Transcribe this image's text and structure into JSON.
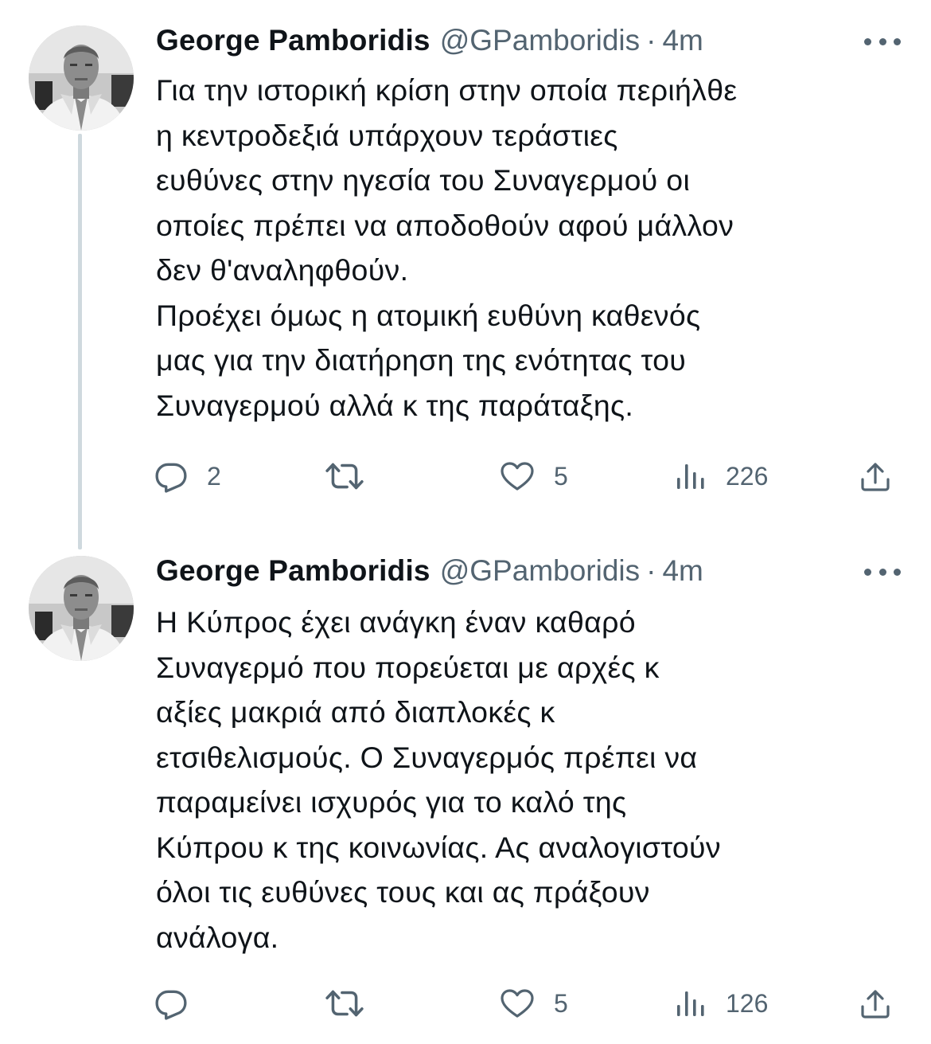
{
  "tweets": [
    {
      "author": {
        "name": "George Pamboridis",
        "handle": "@GPamboridis",
        "separator": "·",
        "time": "4m"
      },
      "text_lines": [
        "Για την ιστορική κρίση στην οποία περιήλθε",
        "η κεντροδεξιά υπάρχουν τεράστιες",
        "ευθύνες στην ηγεσία του Συναγερμού οι",
        "οποίες πρέπει να αποδοθούν αφού μάλλον",
        "δεν θ'αναληφθούν.",
        "Προέχει όμως η ατομική ευθύνη καθενός",
        "μας για την διατήρηση της ενότητας του",
        "Συναγερμού αλλά κ της παράταξης."
      ],
      "stats": {
        "replies": "2",
        "retweets": "",
        "likes": "5",
        "views": "226"
      }
    },
    {
      "author": {
        "name": "George Pamboridis",
        "handle": "@GPamboridis",
        "separator": "·",
        "time": "4m"
      },
      "text_lines": [
        "Η Κύπρος έχει ανάγκη έναν καθαρό",
        "Συναγερμό που πορεύεται με αρχές κ",
        "αξίες μακριά από διαπλοκές κ",
        "ετσιθελισμούς. Ο Συναγερμός πρέπει να",
        "παραμείνει ισχυρός για το καλό της",
        "Κύπρου κ της κοινωνίας. Ας αναλογιστούν",
        "όλοι τις ευθύνες τους και ας πράξουν",
        "ανάλογα."
      ],
      "stats": {
        "replies": "",
        "retweets": "",
        "likes": "5",
        "views": "126"
      }
    }
  ],
  "icons": {
    "avatar": "profile-photo",
    "more": "more-dots-icon",
    "reply": "reply-bubble-icon",
    "retweet": "retweet-icon",
    "like": "heart-icon",
    "views": "views-chart-icon",
    "share": "share-upload-icon"
  },
  "colors": {
    "text": "#0f1419",
    "secondary": "#536471",
    "thread_line": "#cfd9de",
    "background": "#ffffff"
  }
}
